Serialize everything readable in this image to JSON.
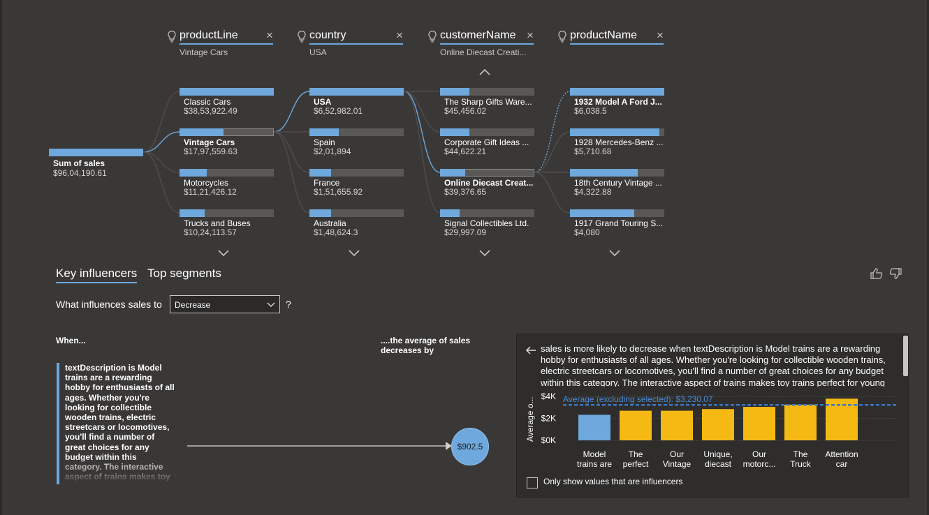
{
  "tree": {
    "root": {
      "label": "Sum of sales",
      "value": "$96,04,190.61"
    },
    "columns": [
      {
        "header": "productLine",
        "subtitle": "Vintage Cars",
        "nodes": [
          {
            "label": "Classic Cars",
            "value": "$38,53,922.49",
            "fill": 1.0
          },
          {
            "label": "Vintage Cars",
            "value": "$17,97,559.63",
            "fill": 0.47,
            "selected": true
          },
          {
            "label": "Motorcycles",
            "value": "$11,21,426.12",
            "fill": 0.29
          },
          {
            "label": "Trucks and Buses",
            "value": "$10,24,113.57",
            "fill": 0.27
          }
        ]
      },
      {
        "header": "country",
        "subtitle": "USA",
        "nodes": [
          {
            "label": "USA",
            "value": "$6,52,982.01",
            "fill": 1.0,
            "selected": true
          },
          {
            "label": "Spain",
            "value": "$2,01,894",
            "fill": 0.31
          },
          {
            "label": "France",
            "value": "$1,51,655.92",
            "fill": 0.23
          },
          {
            "label": "Australia",
            "value": "$1,48,624.3",
            "fill": 0.23
          }
        ]
      },
      {
        "header": "customerName",
        "subtitle": "Online Diecast Creati...",
        "nodes": [
          {
            "label": "The Sharp Gifts Ware...",
            "value": "$45,456.02",
            "fill": 0.31
          },
          {
            "label": "Corporate Gift Ideas ...",
            "value": "$44,622.21",
            "fill": 0.31
          },
          {
            "label": "Online Diecast Creat...",
            "value": "$39,376.65",
            "fill": 0.27,
            "selected": true
          },
          {
            "label": "Signal Collectibles Ltd.",
            "value": "$29,997.09",
            "fill": 0.21
          }
        ]
      },
      {
        "header": "productName",
        "subtitle": "",
        "nodes": [
          {
            "label": "1932 Model A Ford J...",
            "value": "$6,038.5",
            "fill": 1.0,
            "selected": true
          },
          {
            "label": "1928 Mercedes-Benz ...",
            "value": "$5,710.68",
            "fill": 0.95
          },
          {
            "label": "18th Century Vintage ...",
            "value": "$4,322.88",
            "fill": 0.72
          },
          {
            "label": "1917 Grand Touring S...",
            "value": "$4,080",
            "fill": 0.68
          }
        ]
      }
    ]
  },
  "influencers": {
    "tabs": [
      "Key influencers",
      "Top segments"
    ],
    "question_label": "What influences sales to",
    "dropdown_value": "Decrease",
    "help_mark": "?",
    "when_label": "When...",
    "avg_label": "....the average of sales decreases by",
    "influencer_text": "textDescription is Model trains are a rewarding hobby for enthusiasts of all ages. Whether you're looking for collectible wooden trains, electric streetcars or locomotives, you'll find a number of great choices for any budget within this category. The interactive aspect of trains makes toy trains perfect for young children. The",
    "bubble_value": "$902.5"
  },
  "detail_panel": {
    "description": "sales is more likely to decrease when textDescription is Model trains are a rewarding hobby for enthusiasts of all ages. Whether you're looking for collectible wooden trains, electric streetcars or locomotives, you'll find a number of great choices for any budget within this category. The interactive aspect of trains makes toy trains perfect for young children. The",
    "checkbox_label": "Only show values that are influencers",
    "checkbox_checked": false
  },
  "chart_data": {
    "type": "bar",
    "ylabel": "Average o...",
    "ytick_labels": [
      "$4K",
      "$2K",
      "$0K"
    ],
    "ylim": [
      0,
      4200
    ],
    "average_line": {
      "label": "Average (excluding selected): $3,230.07",
      "value": 3230.07
    },
    "categories": [
      [
        "Model",
        "trains are"
      ],
      [
        "The",
        "perfect"
      ],
      [
        "Our",
        "Vintage"
      ],
      [
        "Unique,",
        "diecast"
      ],
      [
        "Our",
        "motorc..."
      ],
      [
        "The",
        "Truck"
      ],
      [
        "Attention",
        "car"
      ]
    ],
    "values": [
      2330,
      2700,
      2700,
      2850,
      3050,
      3250,
      3800
    ],
    "highlight_index": 0,
    "colors": {
      "selected": "#6ea8dc",
      "other": "#f5b914",
      "average": "#3a78c2"
    }
  },
  "colors": {
    "accent": "#6ea8dc",
    "background": "#3a3837",
    "bar_track": "#5a5857"
  }
}
